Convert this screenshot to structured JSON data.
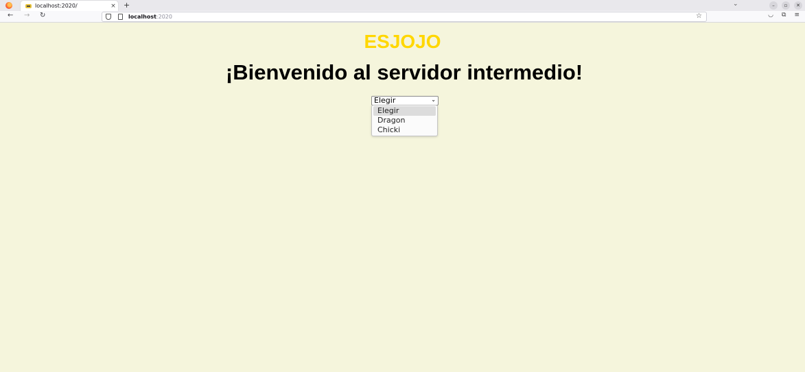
{
  "browser": {
    "tab_title": "localhost:2020/",
    "tab_close": "×",
    "new_tab": "+",
    "url_host": "localhost",
    "url_port": ":2020",
    "icons": [
      "firefox-logo-icon",
      "back-icon",
      "forward-icon",
      "reload-icon",
      "shield-icon",
      "page-icon",
      "bookmark-star-icon",
      "pocket-icon",
      "extensions-icon",
      "menu-icon",
      "minimize-icon",
      "restore-icon",
      "close-icon"
    ]
  },
  "page": {
    "brand": "ESJOJO",
    "welcome": "¡Bienvenido al servidor intermedio!",
    "select_value": "Elegir",
    "options": [
      "Elegir",
      "Dragon",
      "Chicki"
    ]
  },
  "colors": {
    "background": "#f5f5dc",
    "brand": "#ffd700"
  }
}
